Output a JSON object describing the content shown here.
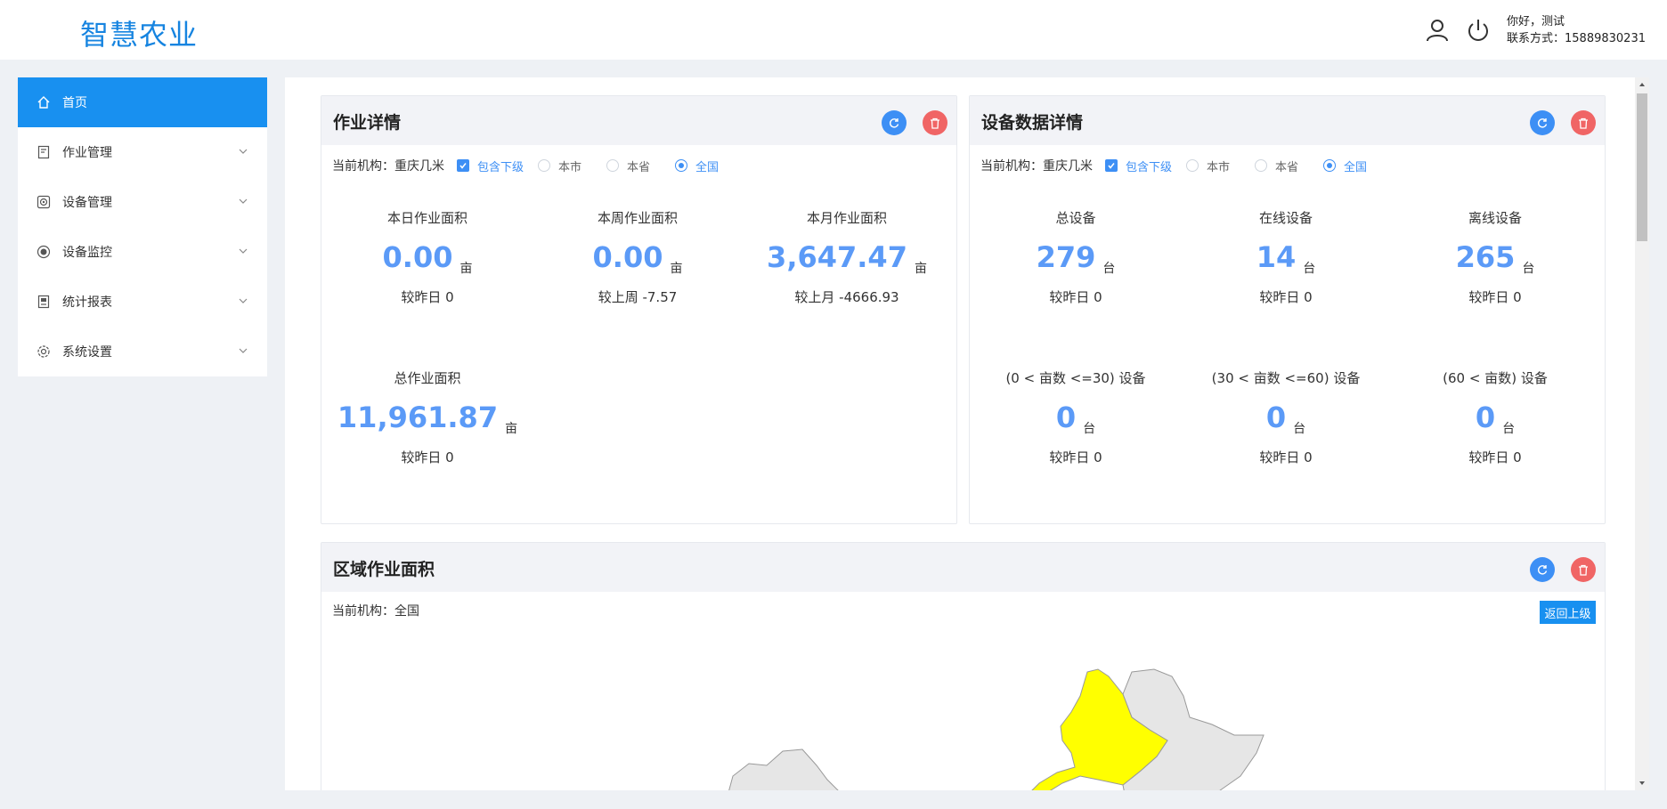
{
  "header": {
    "brand": "智慧农业",
    "greeting": "你好，测试",
    "contact": "联系方式：15889830231",
    "icons": [
      "user-icon",
      "power-icon"
    ]
  },
  "sidebar": {
    "items": [
      {
        "label": "首页",
        "icon": "home-icon",
        "active": true
      },
      {
        "label": "作业管理",
        "icon": "document-icon"
      },
      {
        "label": "设备管理",
        "icon": "device-icon"
      },
      {
        "label": "设备监控",
        "icon": "monitor-icon"
      },
      {
        "label": "统计报表",
        "icon": "report-icon"
      },
      {
        "label": "系统设置",
        "icon": "settings-icon"
      }
    ]
  },
  "work_panel": {
    "title": "作业详情",
    "filter": {
      "org_label": "当前机构：重庆几米",
      "include_sub": "包含下级",
      "city": "本市",
      "province": "本省",
      "national": "全国",
      "selected": "全国"
    },
    "stats": [
      {
        "label": "本日作业面积",
        "value": "0.00",
        "unit": "亩",
        "compare": "较昨日 0"
      },
      {
        "label": "本周作业面积",
        "value": "0.00",
        "unit": "亩",
        "compare": "较上周 -7.57"
      },
      {
        "label": "本月作业面积",
        "value": "3,647.47",
        "unit": "亩",
        "compare": "较上月 -4666.93"
      },
      {
        "label": "总作业面积",
        "value": "11,961.87",
        "unit": "亩",
        "compare": "较昨日 0"
      }
    ]
  },
  "device_panel": {
    "title": "设备数据详情",
    "filter": {
      "org_label": "当前机构：重庆几米",
      "include_sub": "包含下级",
      "city": "本市",
      "province": "本省",
      "national": "全国",
      "selected": "全国"
    },
    "stats": [
      {
        "label": "总设备",
        "value": "279",
        "unit": "台",
        "compare": "较昨日 0"
      },
      {
        "label": "在线设备",
        "value": "14",
        "unit": "台",
        "compare": "较昨日 0"
      },
      {
        "label": "离线设备",
        "value": "265",
        "unit": "台",
        "compare": "较昨日 0"
      },
      {
        "label": "(0 < 亩数 <=30) 设备",
        "value": "0",
        "unit": "台",
        "compare": "较昨日 0"
      },
      {
        "label": "(30 < 亩数 <=60) 设备",
        "value": "0",
        "unit": "台",
        "compare": "较昨日 0"
      },
      {
        "label": "(60 < 亩数) 设备",
        "value": "0",
        "unit": "台",
        "compare": "较昨日 0"
      }
    ]
  },
  "region_panel": {
    "title": "区域作业面积",
    "org_label": "当前机构：全国",
    "back_button": "返回上级",
    "map_colors": {
      "highlight": "#ffff00",
      "default": "#e6e6e6",
      "border": "#999999"
    }
  },
  "colors": {
    "accent": "#1890f0",
    "value_blue": "#5b9af7",
    "refresh": "#3d8ff5",
    "delete": "#f06565"
  }
}
